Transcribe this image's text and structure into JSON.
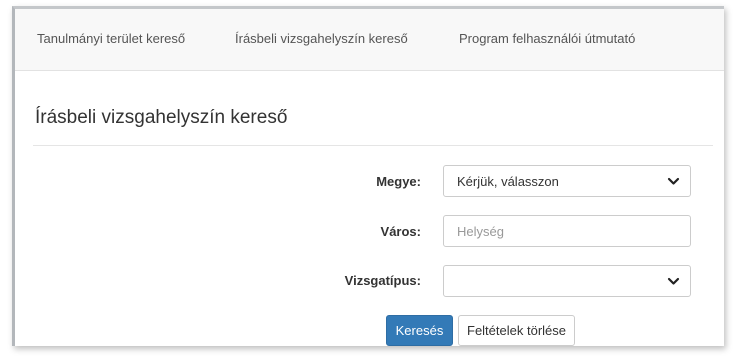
{
  "nav": {
    "items": [
      {
        "label": "Tanulmányi terület kereső"
      },
      {
        "label": "Írásbeli vizsgahelyszín kereső"
      },
      {
        "label": "Program felhasználói útmutató"
      }
    ]
  },
  "page": {
    "title": "Írásbeli vizsgahelyszín kereső"
  },
  "form": {
    "megye": {
      "label": "Megye:",
      "selected": "Kérjük, válasszon"
    },
    "varos": {
      "label": "Város:",
      "placeholder": "Helység",
      "value": ""
    },
    "vizsgatipus": {
      "label": "Vizsgatípus:",
      "selected": ""
    },
    "search_label": "Keresés",
    "clear_label": "Feltételek törlése"
  },
  "colors": {
    "primary": "#337ab7",
    "nav_background": "#f8f8f8"
  },
  "icons": {
    "select_arrow": "chevron-down-icon"
  }
}
